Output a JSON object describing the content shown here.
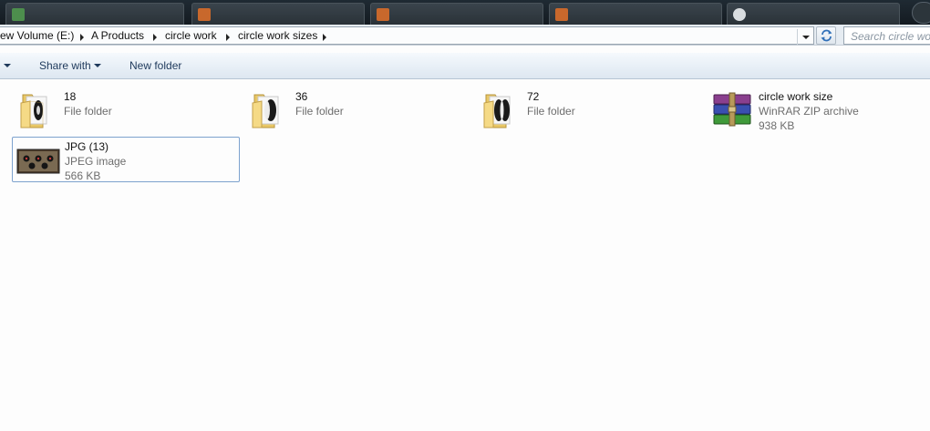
{
  "breadcrumb": {
    "items": [
      "ew Volume (E:)",
      "A Products",
      "circle work",
      "circle work sizes"
    ]
  },
  "search": {
    "placeholder": "Search circle wor"
  },
  "toolbar": {
    "share_label": "Share with",
    "new_folder_label": "New folder"
  },
  "files": [
    {
      "name": "18",
      "type": "File folder",
      "icon": "folder-icon"
    },
    {
      "name": "36",
      "type": "File folder",
      "icon": "folder-icon"
    },
    {
      "name": "72",
      "type": "File folder",
      "icon": "folder-icon"
    },
    {
      "name": "circle work size",
      "type": "WinRAR ZIP archive",
      "size": "938 KB",
      "icon": "winrar-archive-icon"
    },
    {
      "name": "JPG (13)",
      "type": "JPEG image",
      "size": "566 KB",
      "icon": "jpeg-thumbnail-icon"
    }
  ],
  "colors": {
    "toolbar_text": "#1e395b",
    "selection_border": "#7da2ce",
    "secondary_text": "#6d6d6d",
    "folder_yellow": "#f2d47a"
  }
}
